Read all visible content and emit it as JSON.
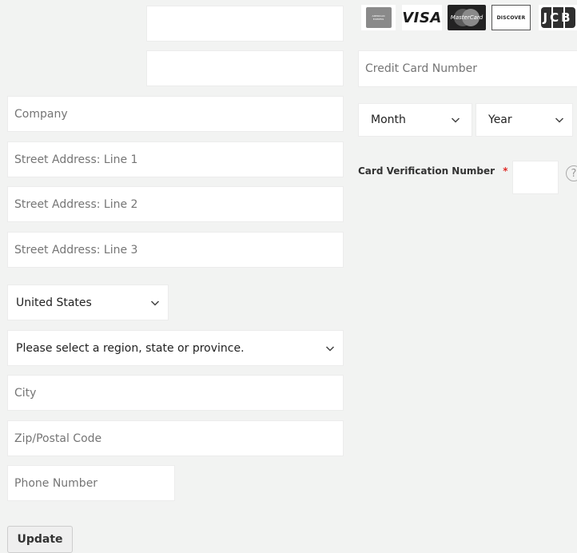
{
  "billing": {
    "name_first_value": "",
    "name_last_value": "",
    "company_placeholder": "Company",
    "street1_placeholder": "Street Address: Line 1",
    "street2_placeholder": "Street Address: Line 2",
    "street3_placeholder": "Street Address: Line 3",
    "country_selected": "United States",
    "region_selected": "Please select a region, state or province.",
    "city_placeholder": "City",
    "zip_placeholder": "Zip/Postal Code",
    "phone_placeholder": "Phone Number",
    "update_label": "Update"
  },
  "payment": {
    "card_logos": [
      {
        "name": "american-express",
        "label": "AMERICAN EXPRESS"
      },
      {
        "name": "visa",
        "label": "VISA"
      },
      {
        "name": "mastercard",
        "label": "MasterCard"
      },
      {
        "name": "discover",
        "label": "DISCOVER"
      },
      {
        "name": "jcb",
        "label": "JCB"
      }
    ],
    "card_number_placeholder": "Credit Card Number",
    "month_selected": "Month",
    "year_selected": "Year",
    "cvv_label": "Card Verification Number",
    "required_marker": "*",
    "help_glyph": "?"
  },
  "colors": {
    "background": "#f2f3f2",
    "field_bg": "#ffffff",
    "required": "#e02b27"
  }
}
